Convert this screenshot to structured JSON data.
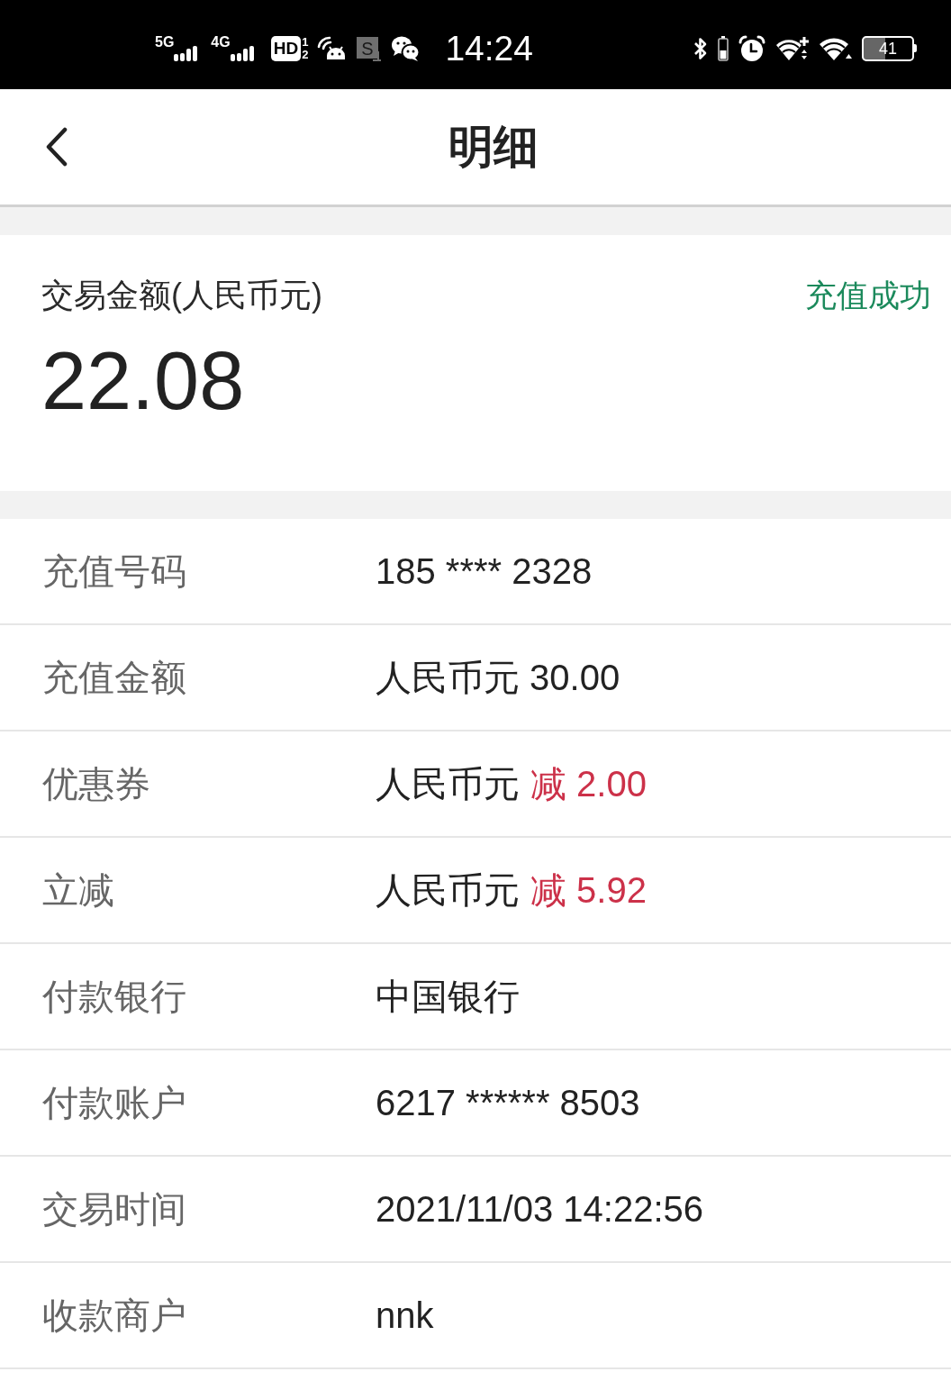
{
  "status_bar": {
    "networks": [
      {
        "label": "5G"
      },
      {
        "label": "4G"
      }
    ],
    "hd_badge": {
      "label": "HD",
      "sims": [
        "1",
        "2"
      ]
    },
    "screenshot_badge": "S",
    "time": "14:24",
    "battery": "41"
  },
  "header": {
    "title": "明细"
  },
  "summary": {
    "label": "交易金额(人民币元)",
    "status": "充值成功",
    "amount": "22.08"
  },
  "details": [
    {
      "label": "充值号码",
      "value": "185 **** 2328"
    },
    {
      "label": "充值金额",
      "value": "人民币元 30.00"
    },
    {
      "label": "优惠券",
      "value": "人民币元",
      "deduction": "减 2.00"
    },
    {
      "label": "立减",
      "value": "人民币元",
      "deduction": "减 5.92"
    },
    {
      "label": "付款银行",
      "value": "中国银行"
    },
    {
      "label": "付款账户",
      "value": "6217 ****** 8503"
    },
    {
      "label": "交易时间",
      "value": "2021/11/03 14:22:56"
    },
    {
      "label": "收款商户",
      "value": "nnk"
    }
  ]
}
